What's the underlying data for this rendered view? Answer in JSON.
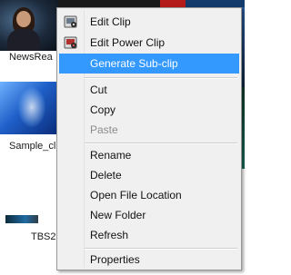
{
  "bin": {
    "tiles": [
      {
        "caption": "NewsRea"
      },
      {
        "caption": "Sample_cl"
      },
      {
        "caption": "TBS2"
      }
    ]
  },
  "context_menu": {
    "items": [
      {
        "label": "Edit Clip",
        "icon": "edit-clip-icon",
        "state": "normal"
      },
      {
        "label": "Edit Power Clip",
        "icon": "edit-power-clip-icon",
        "state": "normal"
      },
      {
        "label": "Generate Sub-clip",
        "state": "selected"
      },
      {
        "label": "Cut",
        "state": "normal"
      },
      {
        "label": "Copy",
        "state": "normal"
      },
      {
        "label": "Paste",
        "state": "disabled"
      },
      {
        "label": "Rename",
        "state": "normal"
      },
      {
        "label": "Delete",
        "state": "normal"
      },
      {
        "label": "Open File Location",
        "state": "normal"
      },
      {
        "label": "New Folder",
        "state": "normal"
      },
      {
        "label": "Refresh",
        "state": "normal"
      },
      {
        "label": "Properties",
        "state": "normal"
      }
    ]
  },
  "colors": {
    "highlight": "#3399ff",
    "menu_background": "#f0f0f0",
    "disabled_text": "#8c8c8c"
  }
}
